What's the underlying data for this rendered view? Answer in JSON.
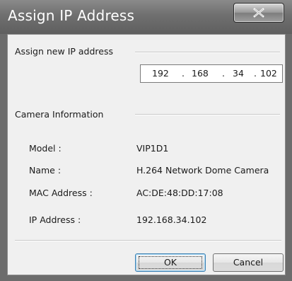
{
  "window": {
    "title": "Assign IP Address"
  },
  "assign_section": {
    "label": "Assign new IP address"
  },
  "ip_input": {
    "octets": [
      "192",
      "168",
      "34",
      "102"
    ],
    "separator": "."
  },
  "camera_section": {
    "label": "Camera Information",
    "fields": [
      {
        "label": "Model :",
        "value": "VIP1D1"
      },
      {
        "label": "Name :",
        "value": "H.264 Network Dome Camera"
      },
      {
        "label": "MAC Address :",
        "value": "AC:DE:48:DD:17:08"
      },
      {
        "label": "IP Address :",
        "value": "192.168.34.102"
      }
    ]
  },
  "buttons": {
    "ok": "OK",
    "cancel": "Cancel"
  },
  "colors": {
    "titlebar": "#6f6f6f",
    "dialog_bg": "#f0f0f0",
    "ok_border": "#3c7fb1"
  }
}
